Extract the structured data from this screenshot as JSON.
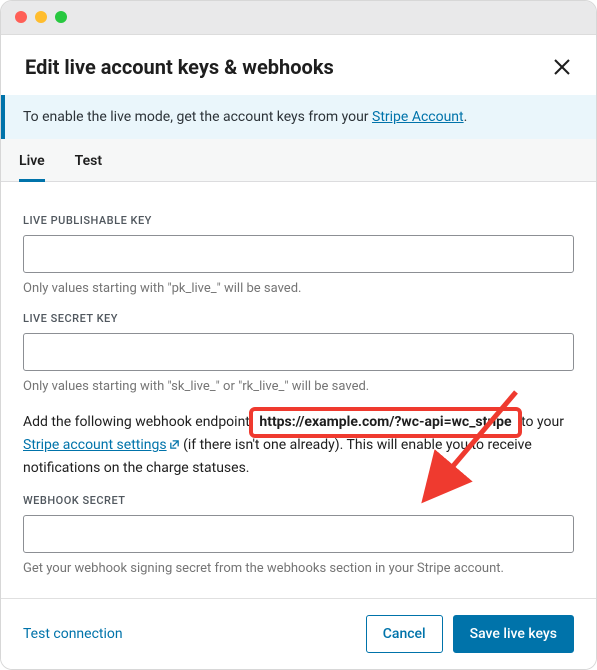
{
  "header": {
    "title": "Edit live account keys & webhooks"
  },
  "notice": {
    "text_before": "To enable the live mode, get the account keys from your ",
    "link_text": "Stripe Account",
    "text_after": "."
  },
  "tabs": {
    "live": "Live",
    "test": "Test"
  },
  "fields": {
    "pub_key": {
      "label": "LIVE PUBLISHABLE KEY",
      "value": "",
      "help": "Only values starting with \"pk_live_\" will be saved."
    },
    "secret_key": {
      "label": "LIVE SECRET KEY",
      "value": "",
      "help": "Only values starting with \"sk_live_\" or \"rk_live_\" will be saved."
    },
    "webhook_info": {
      "before": "Add the following webhook endpoint ",
      "endpoint": "https://example.com/?wc-api=wc_stripe",
      "mid": " to your ",
      "link": "Stripe account settings",
      "after": " (if there isn't one already). This will enable you to receive notifications on the charge statuses."
    },
    "webhook_secret": {
      "label": "WEBHOOK SECRET",
      "value": "",
      "help": "Get your webhook signing secret from the webhooks section in your Stripe account."
    }
  },
  "footer": {
    "test_connection": "Test connection",
    "cancel": "Cancel",
    "save": "Save live keys"
  }
}
